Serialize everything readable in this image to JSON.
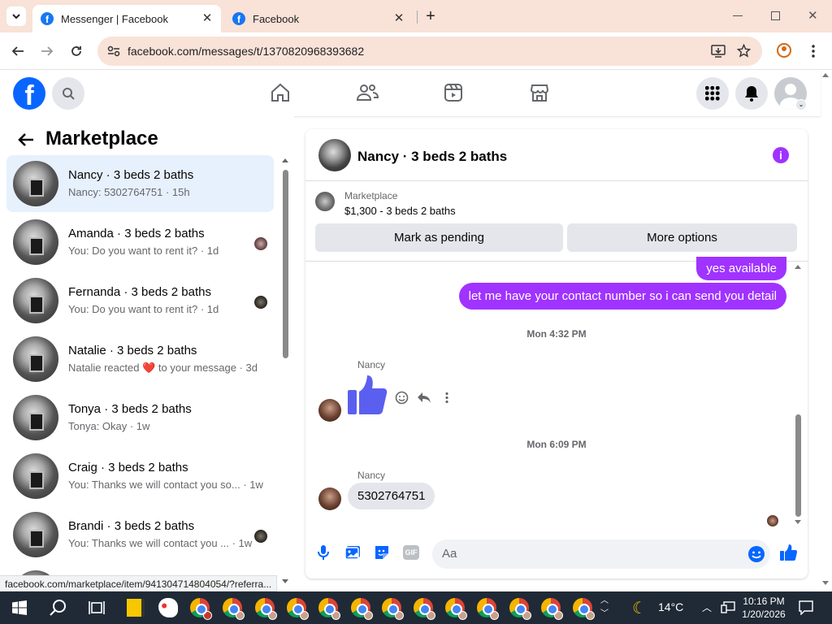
{
  "browser": {
    "tabs": [
      {
        "title": "Messenger | Facebook",
        "active": true
      },
      {
        "title": "Facebook",
        "active": false
      }
    ],
    "url": "facebook.com/messages/t/1370820968393682",
    "status_url": "facebook.com/marketplace/item/941304714804054/?referra..."
  },
  "fb": {
    "logo_letter": "f"
  },
  "left": {
    "title": "Marketplace",
    "threads": [
      {
        "name": "Nancy · 3 beds 2 baths",
        "snippet": "Nancy: 5302764751 · 15h",
        "selected": true,
        "seen": false
      },
      {
        "name": "Amanda · 3 beds 2 baths",
        "snippet": "You: Do you want to rent it? · 1d",
        "selected": false,
        "seen": true
      },
      {
        "name": "Fernanda · 3 beds 2 baths",
        "snippet": "You: Do you want to rent it? · 1d",
        "selected": false,
        "seen": true
      },
      {
        "name": "Natalie · 3 beds 2 baths",
        "snippet_before": "Natalie reacted",
        "snippet_emoji": "❤️",
        "snippet_after": "to your message · 3d",
        "selected": false,
        "seen": false
      },
      {
        "name": "Tonya · 3 beds 2 baths",
        "snippet": "Tonya: Okay · 1w",
        "selected": false,
        "seen": false
      },
      {
        "name": "Craig · 3 beds 2 baths",
        "snippet": "You: Thanks we will contact you so... · 1w",
        "selected": false,
        "seen": false
      },
      {
        "name": "Brandi · 3 beds 2 baths",
        "snippet": "You: Thanks we will contact you ... · 1w",
        "selected": false,
        "seen": true
      }
    ]
  },
  "chat": {
    "title": "Nancy · 3 beds 2 baths",
    "marketplace_label": "Marketplace",
    "listing": "$1,300 - 3 beds 2 baths",
    "mark_pending": "Mark as pending",
    "more_options": "More options",
    "messages": {
      "out1": "yes available",
      "out2": "let me have your contact number so i can send you detail",
      "time1": "Mon 4:32 PM",
      "sender1": "Nancy",
      "time2": "Mon 6:09 PM",
      "sender2": "Nancy",
      "in2": "5302764751"
    },
    "composer_placeholder": "Aa",
    "gif_label": "GIF"
  },
  "taskbar": {
    "temperature": "14°C",
    "time": "10:16 PM",
    "date": "1/20/2026"
  },
  "colors": {
    "accent_purple": "#a033ff",
    "fb_blue": "#0866ff",
    "tab_bg": "#f9e2d8",
    "taskbar": "#1f2a36"
  }
}
